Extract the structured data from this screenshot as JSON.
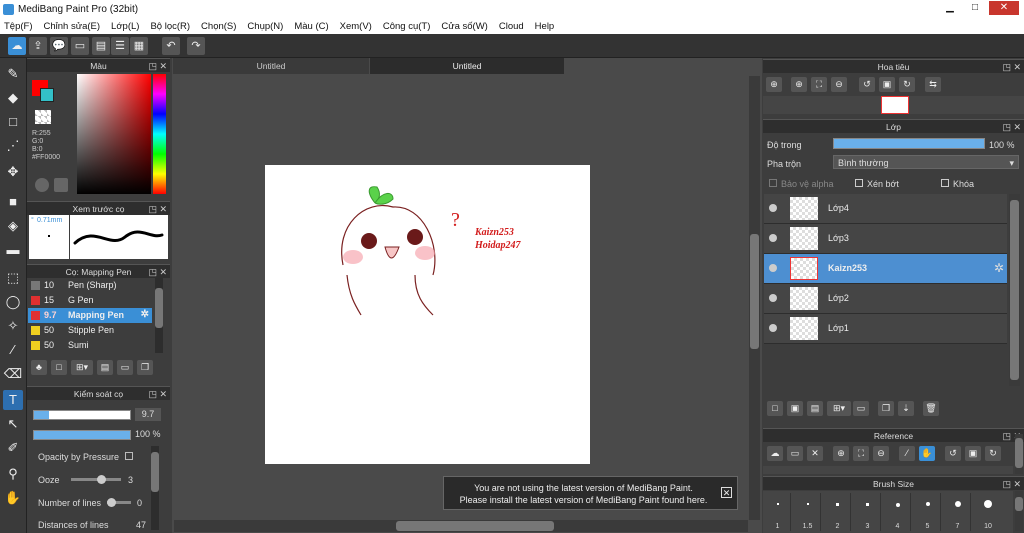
{
  "window": {
    "title": "MediBang Paint Pro (32bit)",
    "min": "▁",
    "max": "□",
    "close": "✕"
  },
  "menu": [
    "Tệp(F)",
    "Chỉnh sửa(E)",
    "Lớp(L)",
    "Bộ lọc(R)",
    "Chọn(S)",
    "Chụp(N)",
    "Màu (C)",
    "Xem(V)",
    "Công cụ(T)",
    "Cửa số(W)",
    "Cloud",
    "Help"
  ],
  "color_panel": {
    "title": "Màu",
    "r": "R:255",
    "g": "G:0",
    "b": "B:0",
    "hex": "#FF0000",
    "primary": "#ff0000",
    "secondary": "#33c0c8"
  },
  "preview_panel": {
    "title": "Xem trước cọ",
    "size": "0.71mm"
  },
  "brush_panel": {
    "title": "Cọ: Mapping Pen",
    "items": [
      {
        "size": "10",
        "name": "Pen (Sharp)",
        "color": "#777777"
      },
      {
        "size": "15",
        "name": "G Pen",
        "color": "#e03030"
      },
      {
        "size": "9.7",
        "name": "Mapping Pen",
        "color": "#e03030"
      },
      {
        "size": "50",
        "name": "Stipple Pen",
        "color": "#f0d020"
      },
      {
        "size": "50",
        "name": "Sumi",
        "color": "#f0d020"
      }
    ]
  },
  "brush_control": {
    "title": "Kiểm soát cọ",
    "size_val": "9.7",
    "opacity_val": "100 %",
    "opacity_pressure": "Opacity by Pressure",
    "ooze_label": "Ooze",
    "ooze_val": "3",
    "lines_label": "Number of lines",
    "lines_val": "0",
    "dist_label": "Distances of lines",
    "dist_val": "47"
  },
  "tabs": [
    "Untitled",
    "Untitled"
  ],
  "canvas": {
    "text1": "Kaizn253",
    "text2": "Hoidap247",
    "question": "?"
  },
  "notice": {
    "line1": "You are not using the latest version of MediBang Paint.",
    "line2": "Please install the latest version of MediBang Paint found here."
  },
  "navigator": {
    "title": "Hoa tiêu"
  },
  "layer_panel": {
    "title": "Lớp",
    "opacity_label": "Độ trong",
    "opacity_val": "100 %",
    "blend_label": "Pha trộn",
    "blend_val": "Bình thường",
    "protect_alpha": "Bảo vệ alpha",
    "clip": "Xén bớt",
    "lock": "Khóa",
    "layers": [
      {
        "name": "Lớp4"
      },
      {
        "name": "Lớp3"
      },
      {
        "name": "Kaizn253"
      },
      {
        "name": "Lớp2"
      },
      {
        "name": "Lớp1"
      }
    ]
  },
  "reference": {
    "title": "Reference"
  },
  "brush_size": {
    "title": "Brush Size",
    "sizes": [
      "1",
      "1.5",
      "2",
      "3",
      "4",
      "5",
      "7",
      "10"
    ]
  }
}
